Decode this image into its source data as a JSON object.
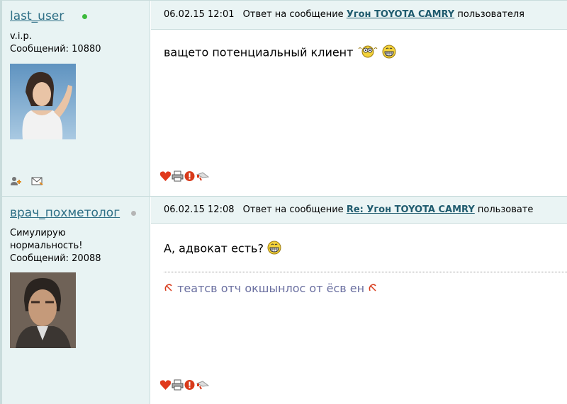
{
  "posts": [
    {
      "username": "last_user",
      "online": true,
      "status": "v.i.p.",
      "posts_count": "Сообщений: 10880",
      "date": "06.02.15 12:01",
      "reply_prefix": "Ответ на сообщение",
      "reply_link": "Угон TOYOTA CAMRY",
      "reply_suffix": "пользователя",
      "message": "ващето потенциальный клиент",
      "signature": ""
    },
    {
      "username": "врач_похметолог",
      "online": false,
      "status_line1": "Симулирую",
      "status_line2": "нормальность!",
      "posts_count": "Сообщений: 20088",
      "date": "06.02.15 12:08",
      "reply_prefix": "Ответ на сообщение",
      "reply_link": "Re: Угон TOYOTA CAMRY",
      "reply_suffix": "пользовате",
      "message": "А, адвокат есть?",
      "signature": "театсв отч окшынлос от ёсв ен"
    }
  ],
  "icons": {
    "user_actions": [
      "add-friend-icon",
      "private-message-icon"
    ],
    "post_actions": [
      "favorite-heart-icon",
      "print-icon",
      "report-icon",
      "quote-megaphone-icon"
    ],
    "smileys": [
      "thinking-smiley-icon",
      "grin-smiley-icon"
    ],
    "signature_marks": [
      "hammer-sickle-icon"
    ]
  },
  "colors": {
    "sidebar_bg": "#e8f3f3",
    "header_bg": "#eaf4f4",
    "username": "#2e6f86",
    "online": "#3cba3c",
    "offline": "#b5b5b5",
    "signature": "#6a6fa0"
  }
}
